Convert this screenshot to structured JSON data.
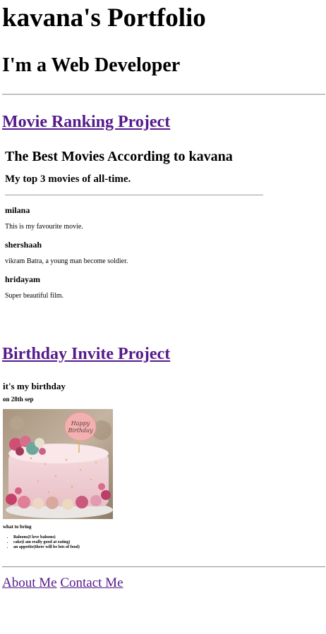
{
  "header": {
    "title": "kavana's Portfolio",
    "subtitle": "I'm a Web Developer"
  },
  "projects": [
    {
      "link_text": "Movie Ranking Project",
      "frame": {
        "title": "The Best Movies According to kavana",
        "subtitle": "My top 3 movies of all-time.",
        "movies": [
          {
            "name": "milana",
            "description": "This is my favourite movie."
          },
          {
            "name": "shershaah",
            "description": "vikram Batra, a young man become soldier."
          },
          {
            "name": "hridayam",
            "description": "Super beautiful film."
          }
        ]
      }
    },
    {
      "link_text": "Birthday Invite Project",
      "frame": {
        "title": "it's my birthday",
        "date": "on 28th sep",
        "cake_topper_line1": "Happy",
        "cake_topper_line2": "Birthday",
        "bring_title": "what to bring",
        "bring_items": [
          "Baloons(I love baloons)",
          "cake(i am really good at eating)",
          "an appetite(there will be lots of food)"
        ]
      }
    }
  ],
  "footer": {
    "about_label": "About Me",
    "contact_label": "Contact Me"
  },
  "colors": {
    "visited_link": "#551a8b",
    "rule": "#9a9a9a"
  }
}
